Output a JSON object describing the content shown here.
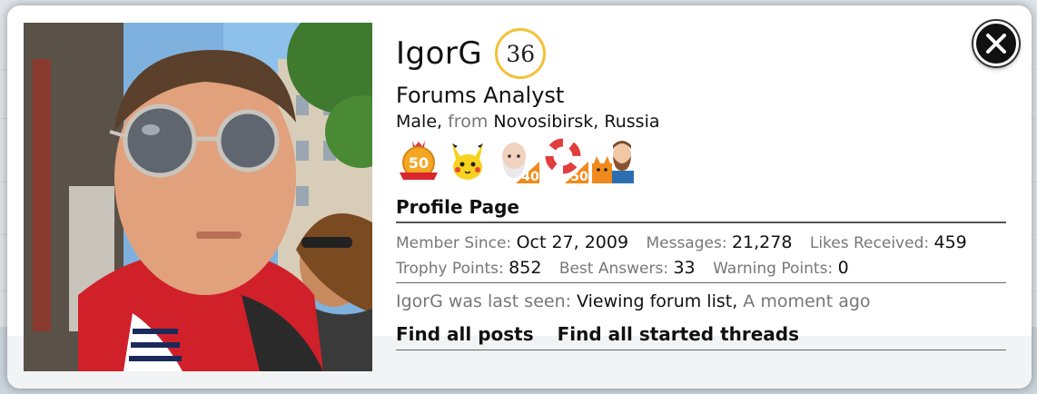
{
  "profile": {
    "username": "IgorG",
    "level": "36",
    "user_title": "Forums Analyst",
    "gender": "Male",
    "from_label": "from",
    "location": "Novosibirsk, Russia"
  },
  "trophies": [
    {
      "icon": "gold-medal-50-trophy-icon",
      "label": "50"
    },
    {
      "icon": "pikachu-trophy-icon",
      "label": ""
    },
    {
      "icon": "old-man-40-trophy-icon",
      "label": "40"
    },
    {
      "icon": "lifebuoy-50-trophy-icon",
      "label": "50"
    },
    {
      "icon": "cat-and-bearded-man-trophy-icon",
      "label": ""
    }
  ],
  "section": {
    "title": "Profile Page"
  },
  "stats": {
    "member_since_label": "Member Since:",
    "member_since": "Oct 27, 2009",
    "messages_label": "Messages:",
    "messages": "21,278",
    "likes_label": "Likes Received:",
    "likes": "459",
    "trophy_points_label": "Trophy Points:",
    "trophy_points": "852",
    "best_answers_label": "Best Answers:",
    "best_answers": "33",
    "warning_points_label": "Warning Points:",
    "warning_points": "0"
  },
  "last_seen": {
    "prefix": "IgorG was last seen:",
    "activity": "Viewing forum list",
    "time": "A moment ago"
  },
  "links": {
    "find_posts": "Find all posts",
    "find_threads": "Find all started threads"
  },
  "colors": {
    "level_ring": "#f3c138",
    "close_button": "#111111"
  }
}
